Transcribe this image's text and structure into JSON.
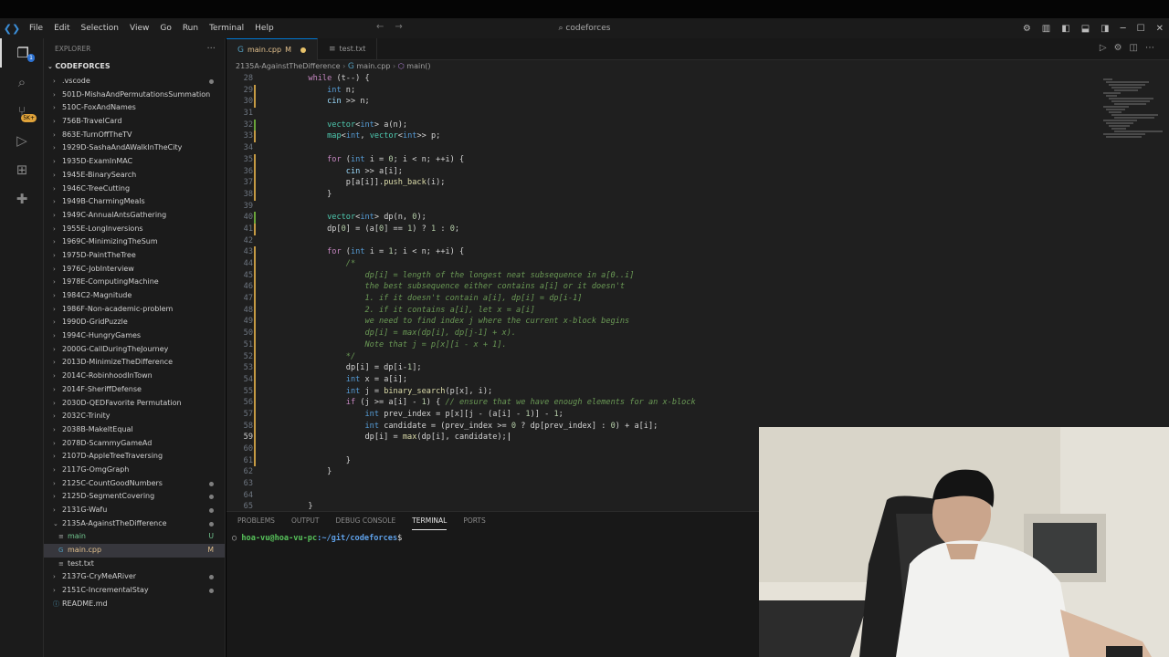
{
  "menu": [
    "File",
    "Edit",
    "Selection",
    "View",
    "Go",
    "Run",
    "Terminal",
    "Help"
  ],
  "command_center": "codeforces",
  "explorer": {
    "header": "EXPLORER",
    "root": "CODEFORCES",
    "items": [
      {
        "label": ".vscode",
        "type": "folder",
        "dot": true
      },
      {
        "label": "501D-MishaAndPermutationsSummation",
        "type": "folder"
      },
      {
        "label": "510C-FoxAndNames",
        "type": "folder"
      },
      {
        "label": "756B-TravelCard",
        "type": "folder"
      },
      {
        "label": "863E-TurnOffTheTV",
        "type": "folder"
      },
      {
        "label": "1929D-SashaAndAWalkInTheCity",
        "type": "folder"
      },
      {
        "label": "1935D-ExamInMAC",
        "type": "folder"
      },
      {
        "label": "1945E-BinarySearch",
        "type": "folder"
      },
      {
        "label": "1946C-TreeCutting",
        "type": "folder"
      },
      {
        "label": "1949B-CharmingMeals",
        "type": "folder"
      },
      {
        "label": "1949C-AnnualAntsGathering",
        "type": "folder"
      },
      {
        "label": "1955E-LongInversions",
        "type": "folder"
      },
      {
        "label": "1969C-MinimizingTheSum",
        "type": "folder"
      },
      {
        "label": "1975D-PaintTheTree",
        "type": "folder"
      },
      {
        "label": "1976C-JobInterview",
        "type": "folder"
      },
      {
        "label": "1978E-ComputingMachine",
        "type": "folder"
      },
      {
        "label": "1984C2-Magnitude",
        "type": "folder"
      },
      {
        "label": "1986F-Non-academic-problem",
        "type": "folder"
      },
      {
        "label": "1990D-GridPuzzle",
        "type": "folder"
      },
      {
        "label": "1994C-HungryGames",
        "type": "folder"
      },
      {
        "label": "2000G-CallDuringTheJourney",
        "type": "folder"
      },
      {
        "label": "2013D-MinimizeTheDifference",
        "type": "folder"
      },
      {
        "label": "2014C-RobinhoodInTown",
        "type": "folder"
      },
      {
        "label": "2014F-SheriffDefense",
        "type": "folder"
      },
      {
        "label": "2030D-QEDFavorite Permutation",
        "type": "folder"
      },
      {
        "label": "2032C-Trinity",
        "type": "folder"
      },
      {
        "label": "2038B-MakeItEqual",
        "type": "folder"
      },
      {
        "label": "2078D-ScammyGameAd",
        "type": "folder"
      },
      {
        "label": "2107D-AppleTreeTraversing",
        "type": "folder"
      },
      {
        "label": "2117G-OmgGraph",
        "type": "folder"
      },
      {
        "label": "2125C-CountGoodNumbers",
        "type": "folder",
        "dot": true
      },
      {
        "label": "2125D-SegmentCovering",
        "type": "folder",
        "dot": true
      },
      {
        "label": "2131G-Wafu",
        "type": "folder",
        "dot": true
      },
      {
        "label": "2135A-AgainstTheDifference",
        "type": "folder-open",
        "dot": true
      },
      {
        "label": "main",
        "type": "file",
        "status": "U",
        "child": true
      },
      {
        "label": "main.cpp",
        "type": "file",
        "status": "M",
        "child": true,
        "selected": true
      },
      {
        "label": "test.txt",
        "type": "file",
        "child": true
      },
      {
        "label": "2137G-CryMeARiver",
        "type": "folder",
        "dot": true
      },
      {
        "label": "2151C-IncrementalStay",
        "type": "folder",
        "dot": true
      },
      {
        "label": "README.md",
        "type": "readme"
      }
    ]
  },
  "tabs": [
    {
      "label": "main.cpp",
      "mod": "M",
      "active": true
    },
    {
      "label": "test.txt",
      "active": false
    }
  ],
  "breadcrumb": {
    "folder": "2135A-AgainstTheDifference",
    "file": "main.cpp",
    "symbol": "main()"
  },
  "code_lines": [
    {
      "n": "28",
      "t": "        while (t--) {"
    },
    {
      "n": "29",
      "t": "            int n;"
    },
    {
      "n": "30",
      "t": "            cin >> n;"
    },
    {
      "n": "31",
      "t": ""
    },
    {
      "n": "32",
      "t": "            vector<int> a(n);"
    },
    {
      "n": "33",
      "t": "            map<int, vector<int>> p;"
    },
    {
      "n": "34",
      "t": ""
    },
    {
      "n": "35",
      "t": "            for (int i = 0; i < n; ++i) {"
    },
    {
      "n": "36",
      "t": "                cin >> a[i];"
    },
    {
      "n": "37",
      "t": "                p[a[i]].push_back(i);"
    },
    {
      "n": "38",
      "t": "            }"
    },
    {
      "n": "39",
      "t": ""
    },
    {
      "n": "40",
      "t": "            vector<int> dp(n, 0);"
    },
    {
      "n": "41",
      "t": "            dp[0] = (a[0] == 1) ? 1 : 0;"
    },
    {
      "n": "42",
      "t": ""
    },
    {
      "n": "43",
      "t": "            for (int i = 1; i < n; ++i) {"
    },
    {
      "n": "44",
      "t": "                /*"
    },
    {
      "n": "45",
      "t": "                    dp[i] = length of the longest neat subsequence in a[0..i]"
    },
    {
      "n": "46",
      "t": "                    the best subsequence either contains a[i] or it doesn't"
    },
    {
      "n": "47",
      "t": "                    1. if it doesn't contain a[i], dp[i] = dp[i-1]"
    },
    {
      "n": "48",
      "t": "                    2. if it contains a[i], let x = a[i]"
    },
    {
      "n": "49",
      "t": "                    we need to find index j where the current x-block begins"
    },
    {
      "n": "50",
      "t": "                    dp[i] = max(dp[i], dp[j-1] + x)."
    },
    {
      "n": "51",
      "t": "                    Note that j = p[x][i - x + 1]."
    },
    {
      "n": "52",
      "t": "                */"
    },
    {
      "n": "53",
      "t": "                dp[i] = dp[i-1];"
    },
    {
      "n": "54",
      "t": "                int x = a[i];"
    },
    {
      "n": "55",
      "t": "                int j = binary_search(p[x], i);"
    },
    {
      "n": "56",
      "t": "                if (j >= a[i] - 1) { // ensure that we have enough elements for an x-block"
    },
    {
      "n": "57",
      "t": "                    int prev_index = p[x][j - (a[i] - 1)] - 1;"
    },
    {
      "n": "58",
      "t": "                    int candidate = (prev_index >= 0 ? dp[prev_index] : 0) + a[i];"
    },
    {
      "n": "59",
      "t": "                    dp[i] = max(dp[i], candidate);"
    },
    {
      "n": "60",
      "t": ""
    },
    {
      "n": "61",
      "t": "                }"
    },
    {
      "n": "62",
      "t": "            }"
    },
    {
      "n": "63",
      "t": ""
    },
    {
      "n": "64",
      "t": ""
    },
    {
      "n": "65",
      "t": "        }"
    }
  ],
  "panel": {
    "tabs": [
      "PROBLEMS",
      "OUTPUT",
      "DEBUG CONSOLE",
      "TERMINAL",
      "PORTS"
    ],
    "active_tab": "TERMINAL",
    "prompt_user": "hoa-vu@hoa-vu-pc",
    "prompt_path": ":~/git/codeforces",
    "prompt_end": "$"
  },
  "activity_badge": "5K+"
}
